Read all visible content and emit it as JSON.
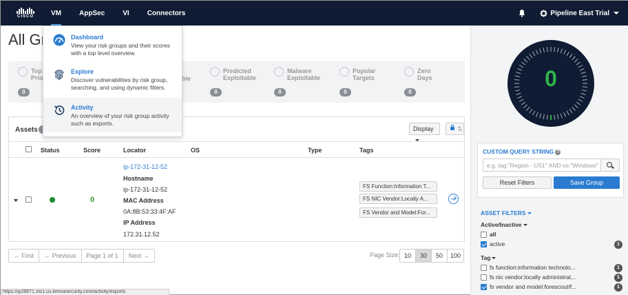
{
  "nav": {
    "logo_text": "CISCO",
    "items": [
      {
        "label": "VM",
        "active": true
      },
      {
        "label": "AppSec",
        "active": false
      },
      {
        "label": "VI",
        "active": false
      },
      {
        "label": "Connectors",
        "active": false
      }
    ],
    "tenant": "Pipeline East Trial"
  },
  "page": {
    "title": "All Gr"
  },
  "stats": [
    {
      "label": "Top\nPrio",
      "count": "0"
    },
    {
      "label": "ble",
      "count": ""
    },
    {
      "label": "Predicted\nExploitable",
      "count": "0"
    },
    {
      "label": "Malware\nExploitable",
      "count": "0"
    },
    {
      "label": "Popular\nTargets",
      "count": "0"
    },
    {
      "label": "Zero\nDays",
      "count": "0"
    }
  ],
  "assets": {
    "title": "Assets",
    "display_label": "Display",
    "sort_arrows": "⇅",
    "columns": [
      "Status",
      "Score",
      "Locator",
      "OS",
      "Type",
      "Tags"
    ],
    "row": {
      "score": "0",
      "locator_link": "ip-172-31-12-52",
      "hostname_label": "Hostname",
      "hostname": "ip-172-31-12-52",
      "mac_label": "MAC Address",
      "mac": "0A:8B:53:33:4F:AF",
      "ip_label": "IP Address",
      "ip": "172.31.12.52",
      "tags": [
        "FS Function:Information T...",
        "FS NIC Vendor:Locally A...",
        "FS Vendor and Model:For..."
      ]
    }
  },
  "pager": {
    "first": "← First",
    "previous": "← Previous",
    "page_info": "Page 1 of 1",
    "next": "Next →",
    "page_size_label": "Page Size:",
    "sizes": [
      "10",
      "30",
      "50",
      "100"
    ],
    "selected_size": "30"
  },
  "status_url": "https://ip28671.sto1.us.kennasecurity.com/activity/exports",
  "vm_menu": [
    {
      "title": "Dashboard",
      "desc": "View your risk groups and their scores with a top level overview.",
      "icon": "speedometer-icon"
    },
    {
      "title": "Explore",
      "desc": "Discover vulnerabilities by risk group, searching, and using dynamic filters.",
      "icon": "fingerprint-icon"
    },
    {
      "title": "Activity",
      "desc": "An overview of your risk group activity such as exports.",
      "icon": "history-icon"
    }
  ],
  "gauge": {
    "value": "0"
  },
  "custom_query": {
    "title": "CUSTOM QUERY STRING",
    "help": "?",
    "placeholder": "e.g. tag:\"Region - US1\" AND os:\"Windows\"",
    "value": "",
    "reset_label": "Reset Filters",
    "save_label": "Save Group"
  },
  "asset_filters": {
    "title": "ASSET FILTERS",
    "active_group": "Active/Inactive",
    "active_options": [
      {
        "label": "all",
        "checked": false,
        "count": "",
        "bold": true
      },
      {
        "label": "active",
        "checked": true,
        "count": "1",
        "bold": false
      }
    ],
    "tag_group": "Tag",
    "tag_options": [
      {
        "label": "fs function:information technolo...",
        "checked": false,
        "count": "1"
      },
      {
        "label": "fs nic vendor:locally administrat...",
        "checked": false,
        "count": "1"
      },
      {
        "label": "fs vendor and model:forescout/f...",
        "checked": true,
        "count": "1"
      }
    ]
  },
  "colors": {
    "nav_bg": "#0f1c33",
    "accent": "#2b7bd0",
    "score_green": "#2fb34a",
    "status_green": "#1a8a2e"
  }
}
